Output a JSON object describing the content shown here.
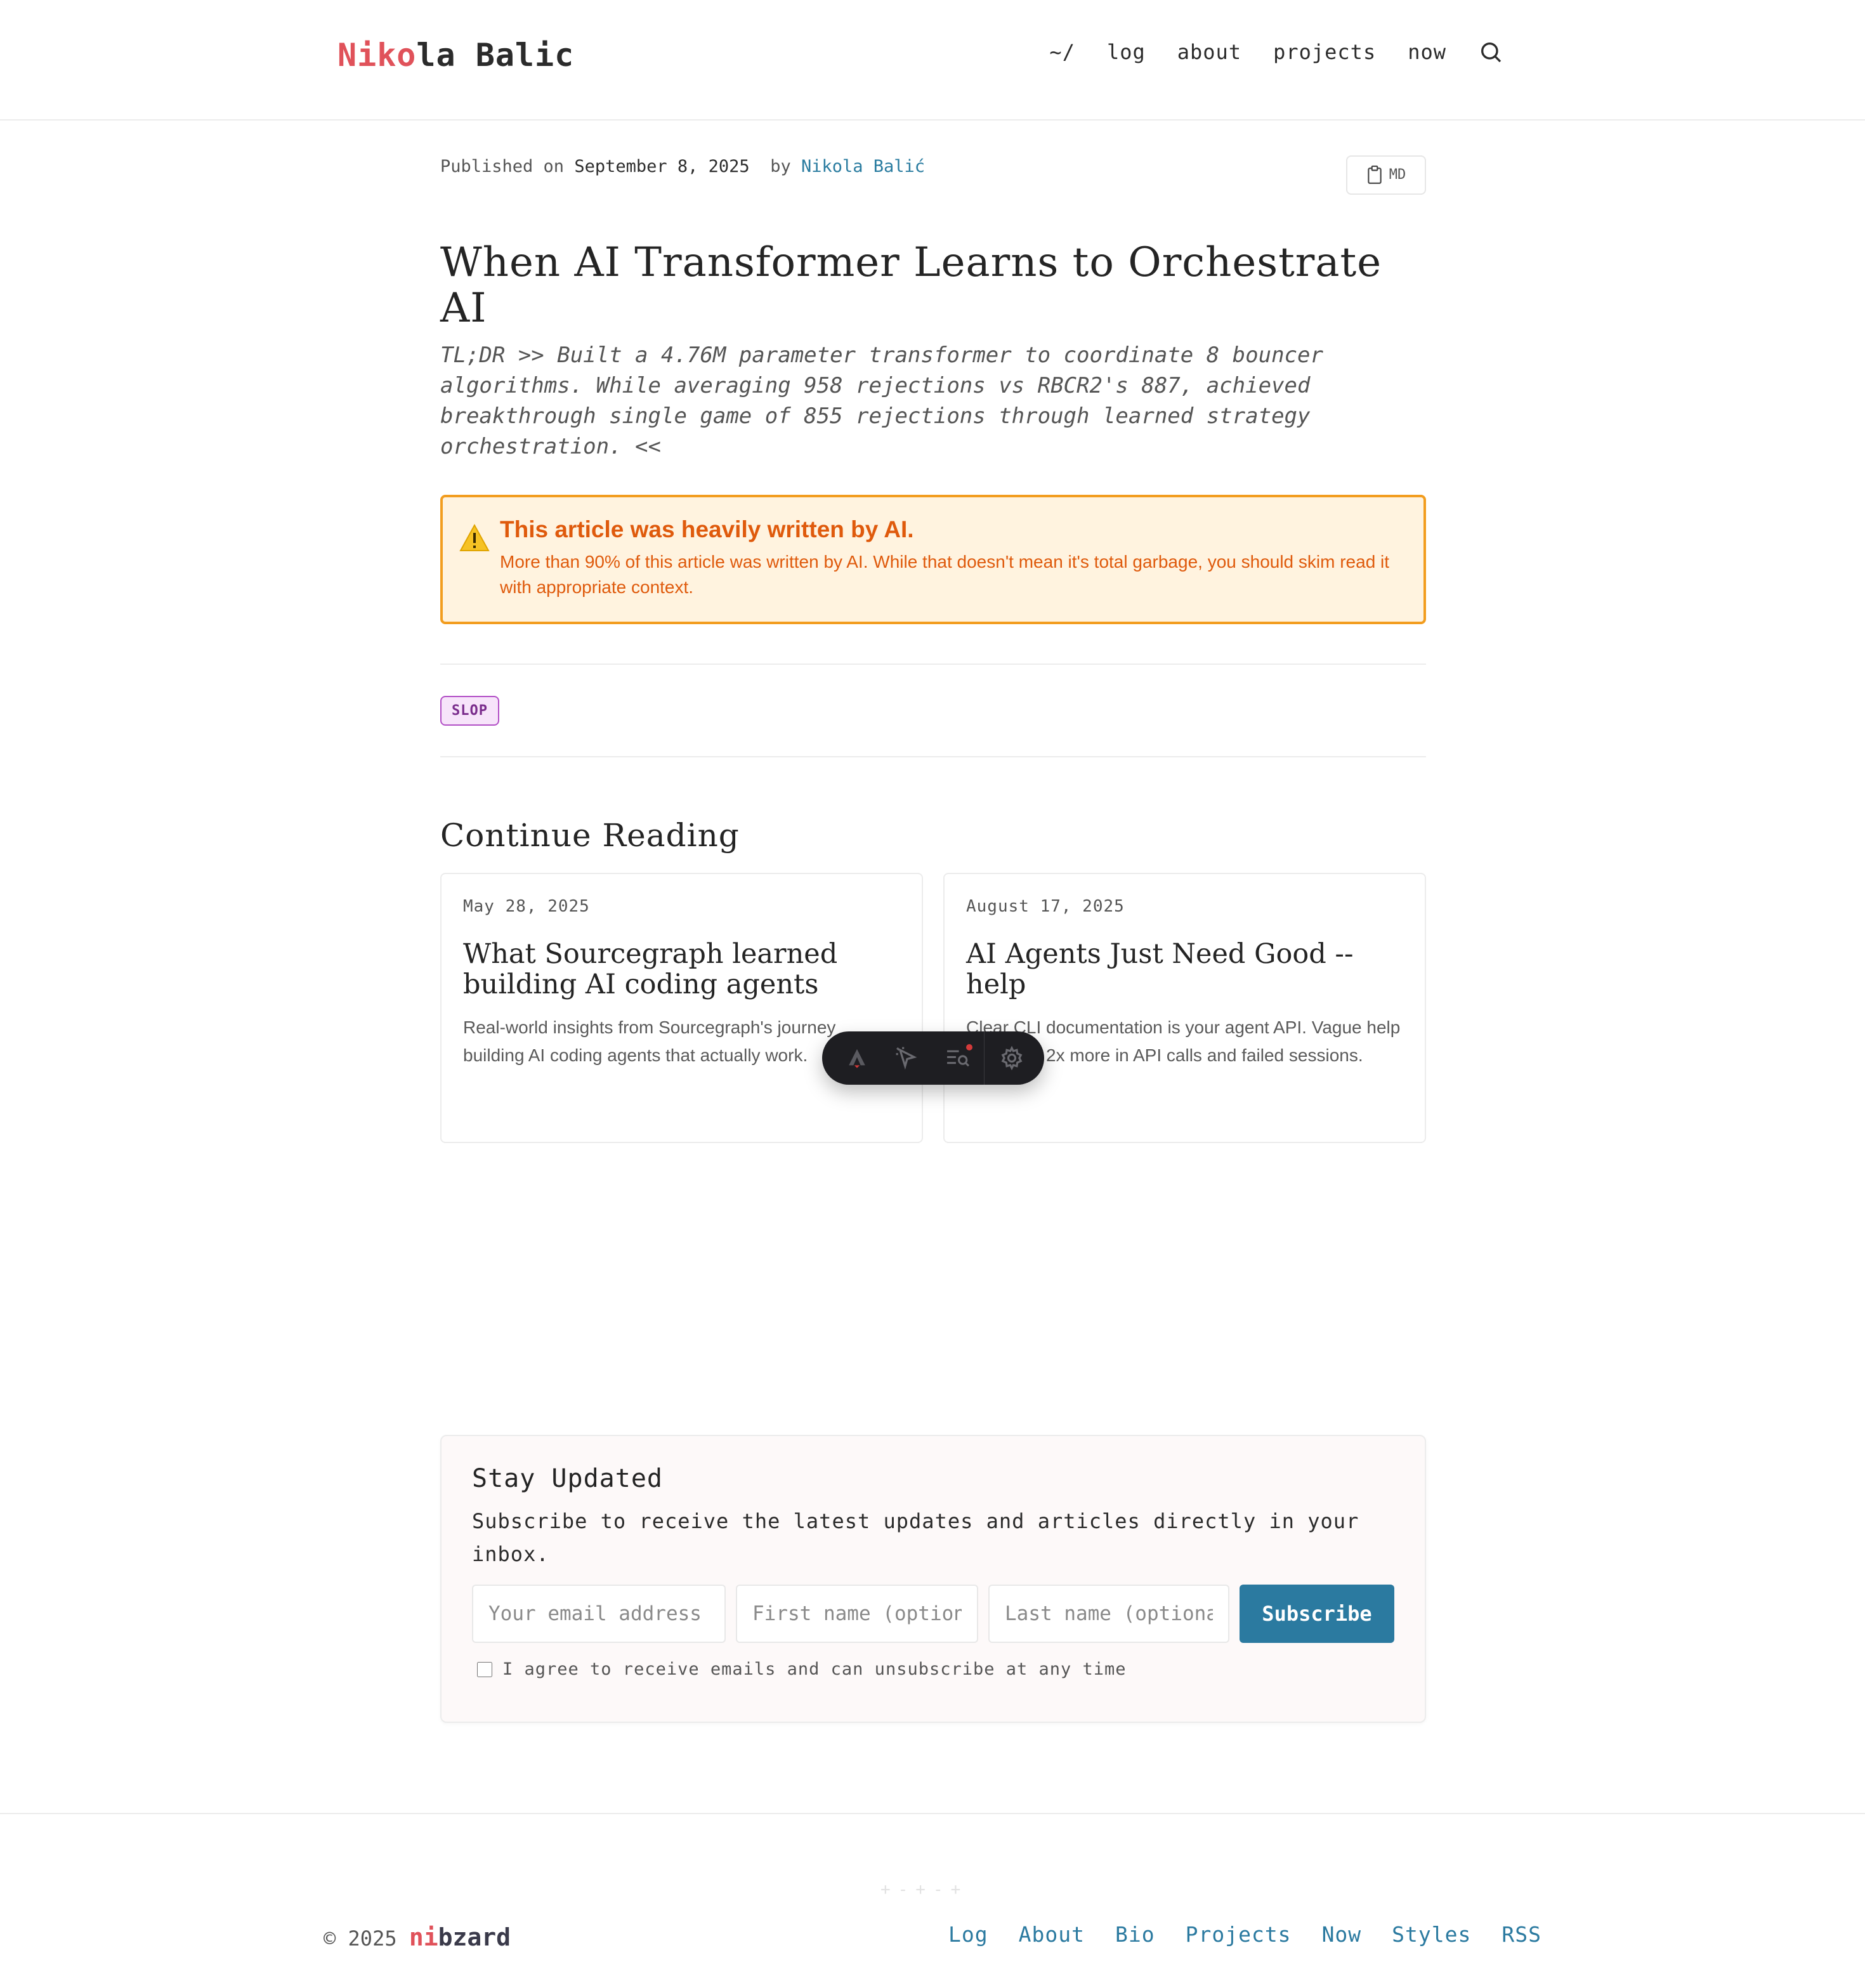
{
  "header": {
    "logo_accent": "Niko",
    "logo_rest": "la Balic",
    "nav": [
      "~/",
      "log",
      "about",
      "projects",
      "now"
    ],
    "search_icon": "search-icon"
  },
  "article": {
    "published_prefix": "Published on",
    "date": "September 8, 2025",
    "by": "by",
    "author": "Nikola Balić",
    "md_label": "MD",
    "title": "When AI Transformer Learns to Orchestrate AI",
    "tldr": "TL;DR >> Built a 4.76M parameter transformer to coordinate 8 bouncer algorithms. While averaging 958 rejections vs RBCR2's 887, achieved breakthrough single game of 855 rejections through learned strategy orchestration. <<",
    "warning": {
      "title": "This article was heavily written by AI.",
      "body": "More than 90% of this article was written by AI. While that doesn't mean it's total garbage, you should skim read it with appropriate context.",
      "icon": "warning-icon"
    },
    "tag": "SLOP"
  },
  "continue": {
    "heading": "Continue Reading",
    "cards": [
      {
        "date": "May 28, 2025",
        "title": "What Sourcegraph learned building AI coding agents",
        "desc": "Real-world insights from Sourcegraph's journey building AI coding agents that actually work."
      },
      {
        "date": "August 17, 2025",
        "title": "AI Agents Just Need Good --help",
        "desc": "Clear CLI documentation is your agent API. Vague help text costs 2x more in API calls and failed sessions."
      }
    ]
  },
  "subscribe": {
    "title": "Stay Updated",
    "desc": "Subscribe to receive the latest updates and articles directly in your inbox.",
    "email_placeholder": "Your email address",
    "first_placeholder": "First name (optional)",
    "last_placeholder": "Last name (optional)",
    "button": "Subscribe",
    "consent": "I agree to receive emails and can unsubscribe at any time"
  },
  "footer": {
    "copyright": "© 2025",
    "brand_accent": "ni",
    "brand_rest": "bzard",
    "links": [
      "Log",
      "About",
      "Bio",
      "Projects",
      "Now",
      "Styles",
      "RSS"
    ]
  },
  "colors": {
    "accent_red": "#e0525a",
    "link_blue": "#2b7aa0",
    "warning_orange": "#df5a0c"
  }
}
